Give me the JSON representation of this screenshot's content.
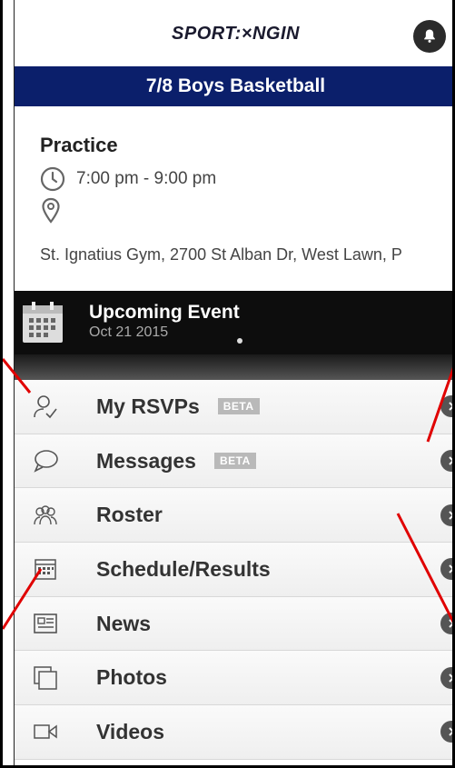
{
  "header": {
    "logo_text": "SPORT:×NGIN"
  },
  "team": {
    "name": "7/8 Boys Basketball"
  },
  "event": {
    "title": "Practice",
    "time": "7:00 pm - 9:00 pm",
    "location": "St. Ignatius Gym, 2700 St Alban Dr, West Lawn, P"
  },
  "upcoming": {
    "title": "Upcoming Event",
    "date": "Oct 21 2015"
  },
  "menu": {
    "items": [
      {
        "label": "My RSVPs",
        "badge": "BETA",
        "icon": "rsvp-icon"
      },
      {
        "label": "Messages",
        "badge": "BETA",
        "icon": "speech-bubble-icon"
      },
      {
        "label": "Roster",
        "icon": "people-icon"
      },
      {
        "label": "Schedule/Results",
        "icon": "calendar-icon"
      },
      {
        "label": "News",
        "icon": "newspaper-icon"
      },
      {
        "label": "Photos",
        "icon": "photos-icon"
      },
      {
        "label": "Videos",
        "icon": "video-camera-icon"
      }
    ]
  },
  "colors": {
    "team_bar": "#0b1f6b",
    "annotation_lines": "#e00000"
  }
}
